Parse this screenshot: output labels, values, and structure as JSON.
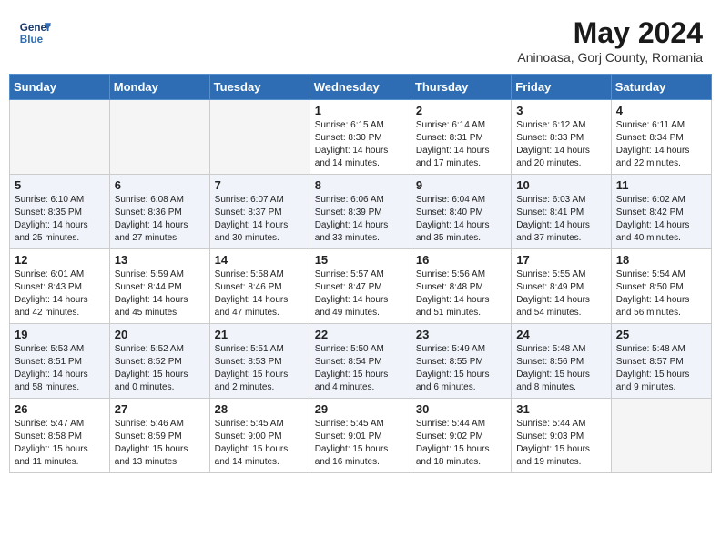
{
  "header": {
    "logo_line1": "General",
    "logo_line2": "Blue",
    "month": "May 2024",
    "location": "Aninoasa, Gorj County, Romania"
  },
  "weekdays": [
    "Sunday",
    "Monday",
    "Tuesday",
    "Wednesday",
    "Thursday",
    "Friday",
    "Saturday"
  ],
  "weeks": [
    [
      {
        "day": "",
        "info": ""
      },
      {
        "day": "",
        "info": ""
      },
      {
        "day": "",
        "info": ""
      },
      {
        "day": "1",
        "info": "Sunrise: 6:15 AM\nSunset: 8:30 PM\nDaylight: 14 hours\nand 14 minutes."
      },
      {
        "day": "2",
        "info": "Sunrise: 6:14 AM\nSunset: 8:31 PM\nDaylight: 14 hours\nand 17 minutes."
      },
      {
        "day": "3",
        "info": "Sunrise: 6:12 AM\nSunset: 8:33 PM\nDaylight: 14 hours\nand 20 minutes."
      },
      {
        "day": "4",
        "info": "Sunrise: 6:11 AM\nSunset: 8:34 PM\nDaylight: 14 hours\nand 22 minutes."
      }
    ],
    [
      {
        "day": "5",
        "info": "Sunrise: 6:10 AM\nSunset: 8:35 PM\nDaylight: 14 hours\nand 25 minutes."
      },
      {
        "day": "6",
        "info": "Sunrise: 6:08 AM\nSunset: 8:36 PM\nDaylight: 14 hours\nand 27 minutes."
      },
      {
        "day": "7",
        "info": "Sunrise: 6:07 AM\nSunset: 8:37 PM\nDaylight: 14 hours\nand 30 minutes."
      },
      {
        "day": "8",
        "info": "Sunrise: 6:06 AM\nSunset: 8:39 PM\nDaylight: 14 hours\nand 33 minutes."
      },
      {
        "day": "9",
        "info": "Sunrise: 6:04 AM\nSunset: 8:40 PM\nDaylight: 14 hours\nand 35 minutes."
      },
      {
        "day": "10",
        "info": "Sunrise: 6:03 AM\nSunset: 8:41 PM\nDaylight: 14 hours\nand 37 minutes."
      },
      {
        "day": "11",
        "info": "Sunrise: 6:02 AM\nSunset: 8:42 PM\nDaylight: 14 hours\nand 40 minutes."
      }
    ],
    [
      {
        "day": "12",
        "info": "Sunrise: 6:01 AM\nSunset: 8:43 PM\nDaylight: 14 hours\nand 42 minutes."
      },
      {
        "day": "13",
        "info": "Sunrise: 5:59 AM\nSunset: 8:44 PM\nDaylight: 14 hours\nand 45 minutes."
      },
      {
        "day": "14",
        "info": "Sunrise: 5:58 AM\nSunset: 8:46 PM\nDaylight: 14 hours\nand 47 minutes."
      },
      {
        "day": "15",
        "info": "Sunrise: 5:57 AM\nSunset: 8:47 PM\nDaylight: 14 hours\nand 49 minutes."
      },
      {
        "day": "16",
        "info": "Sunrise: 5:56 AM\nSunset: 8:48 PM\nDaylight: 14 hours\nand 51 minutes."
      },
      {
        "day": "17",
        "info": "Sunrise: 5:55 AM\nSunset: 8:49 PM\nDaylight: 14 hours\nand 54 minutes."
      },
      {
        "day": "18",
        "info": "Sunrise: 5:54 AM\nSunset: 8:50 PM\nDaylight: 14 hours\nand 56 minutes."
      }
    ],
    [
      {
        "day": "19",
        "info": "Sunrise: 5:53 AM\nSunset: 8:51 PM\nDaylight: 14 hours\nand 58 minutes."
      },
      {
        "day": "20",
        "info": "Sunrise: 5:52 AM\nSunset: 8:52 PM\nDaylight: 15 hours\nand 0 minutes."
      },
      {
        "day": "21",
        "info": "Sunrise: 5:51 AM\nSunset: 8:53 PM\nDaylight: 15 hours\nand 2 minutes."
      },
      {
        "day": "22",
        "info": "Sunrise: 5:50 AM\nSunset: 8:54 PM\nDaylight: 15 hours\nand 4 minutes."
      },
      {
        "day": "23",
        "info": "Sunrise: 5:49 AM\nSunset: 8:55 PM\nDaylight: 15 hours\nand 6 minutes."
      },
      {
        "day": "24",
        "info": "Sunrise: 5:48 AM\nSunset: 8:56 PM\nDaylight: 15 hours\nand 8 minutes."
      },
      {
        "day": "25",
        "info": "Sunrise: 5:48 AM\nSunset: 8:57 PM\nDaylight: 15 hours\nand 9 minutes."
      }
    ],
    [
      {
        "day": "26",
        "info": "Sunrise: 5:47 AM\nSunset: 8:58 PM\nDaylight: 15 hours\nand 11 minutes."
      },
      {
        "day": "27",
        "info": "Sunrise: 5:46 AM\nSunset: 8:59 PM\nDaylight: 15 hours\nand 13 minutes."
      },
      {
        "day": "28",
        "info": "Sunrise: 5:45 AM\nSunset: 9:00 PM\nDaylight: 15 hours\nand 14 minutes."
      },
      {
        "day": "29",
        "info": "Sunrise: 5:45 AM\nSunset: 9:01 PM\nDaylight: 15 hours\nand 16 minutes."
      },
      {
        "day": "30",
        "info": "Sunrise: 5:44 AM\nSunset: 9:02 PM\nDaylight: 15 hours\nand 18 minutes."
      },
      {
        "day": "31",
        "info": "Sunrise: 5:44 AM\nSunset: 9:03 PM\nDaylight: 15 hours\nand 19 minutes."
      },
      {
        "day": "",
        "info": ""
      }
    ]
  ]
}
